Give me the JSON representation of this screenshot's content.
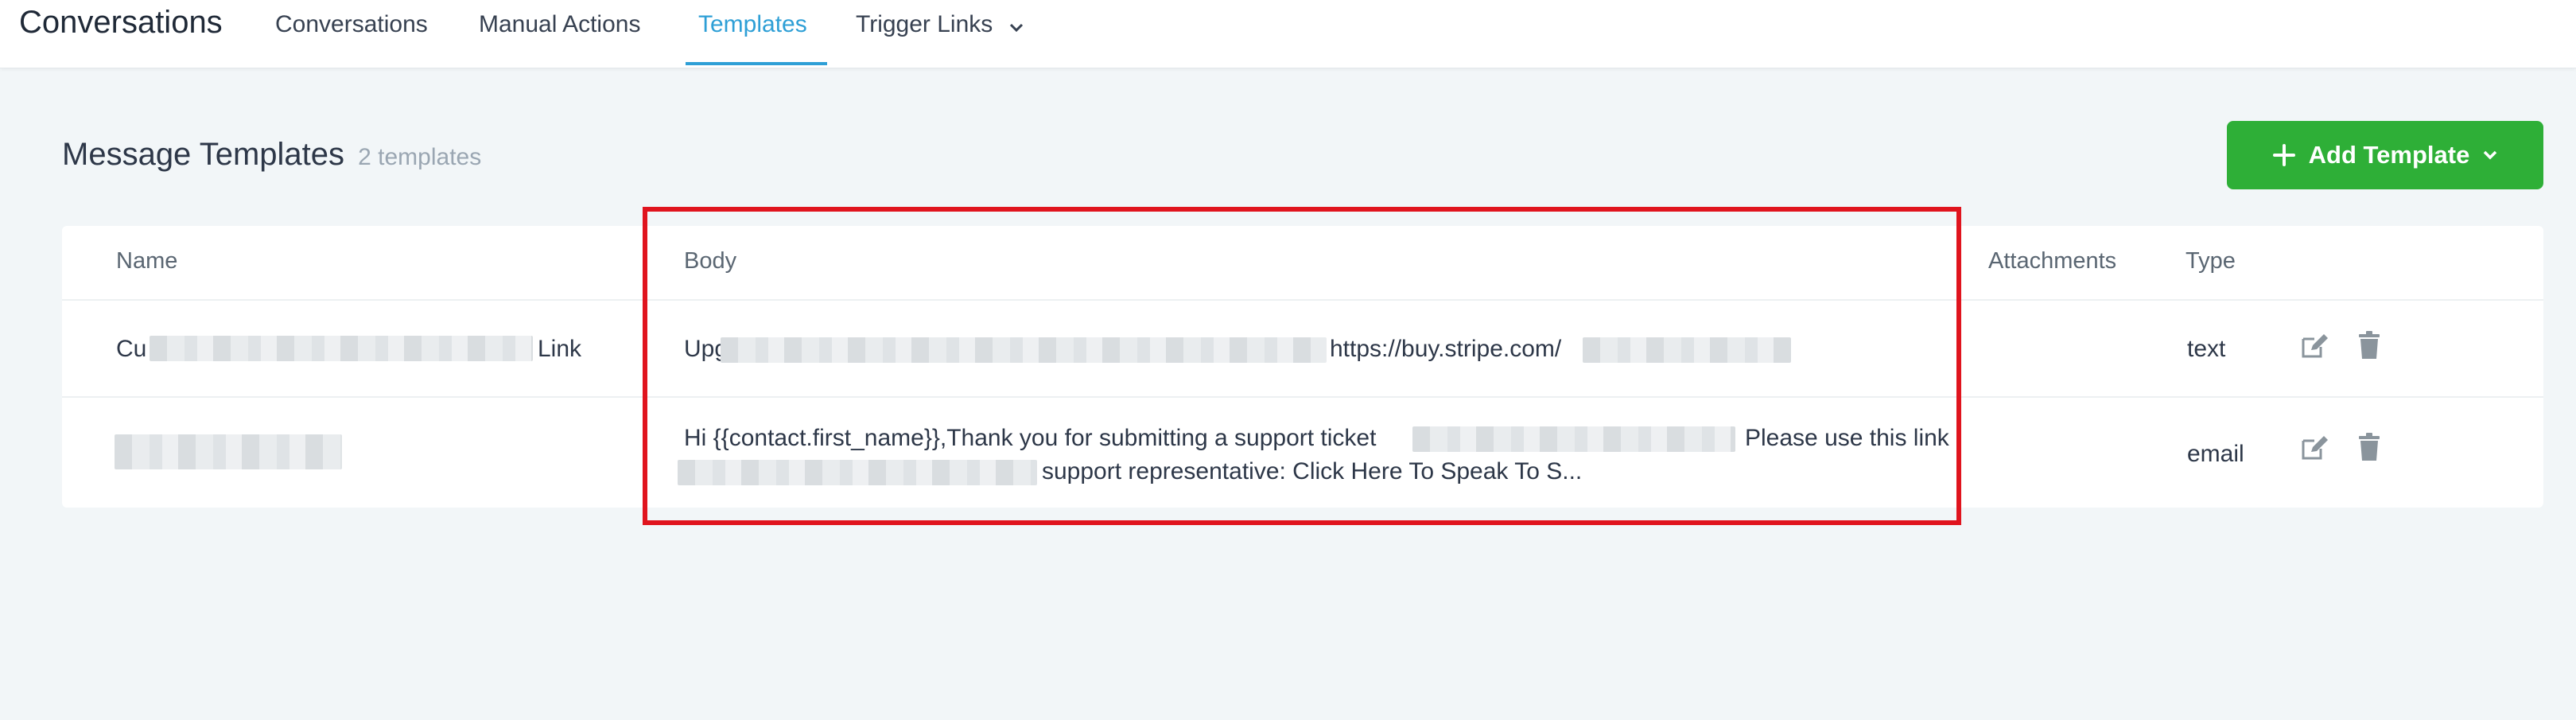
{
  "app": {
    "title": "Conversations"
  },
  "nav": {
    "tabs": [
      {
        "label": "Conversations"
      },
      {
        "label": "Manual Actions"
      },
      {
        "label": "Templates"
      },
      {
        "label": "Trigger Links"
      }
    ],
    "active_tab": "Templates"
  },
  "page": {
    "title": "Message Templates",
    "count": "2 templates"
  },
  "actions": {
    "add_template_label": "Add Template"
  },
  "table": {
    "headers": {
      "name": "Name",
      "body": "Body",
      "attachments": "Attachments",
      "type": "Type"
    },
    "rows": [
      {
        "name_prefix": "Cu",
        "name_suffix": "Link",
        "body_prefix": "Upg",
        "body_link": "https://buy.stripe.com/",
        "type": "text"
      },
      {
        "body_line1": "Hi {{contact.first_name}},Thank you for submitting a support ticket",
        "body_line1_end": "Please use this link",
        "body_line2": "support representative: Click Here To Speak To S...",
        "type": "email"
      }
    ]
  },
  "colors": {
    "accent": "#2e9fd6",
    "add_button": "#2eaf37",
    "highlight": "#e0141e",
    "background": "#f2f6f8"
  },
  "icons": {
    "nav_dropdown": "chevron-down-icon",
    "add": "plus-icon",
    "add_dropdown": "chevron-down-icon",
    "edit": "edit-icon",
    "delete": "trash-icon"
  }
}
